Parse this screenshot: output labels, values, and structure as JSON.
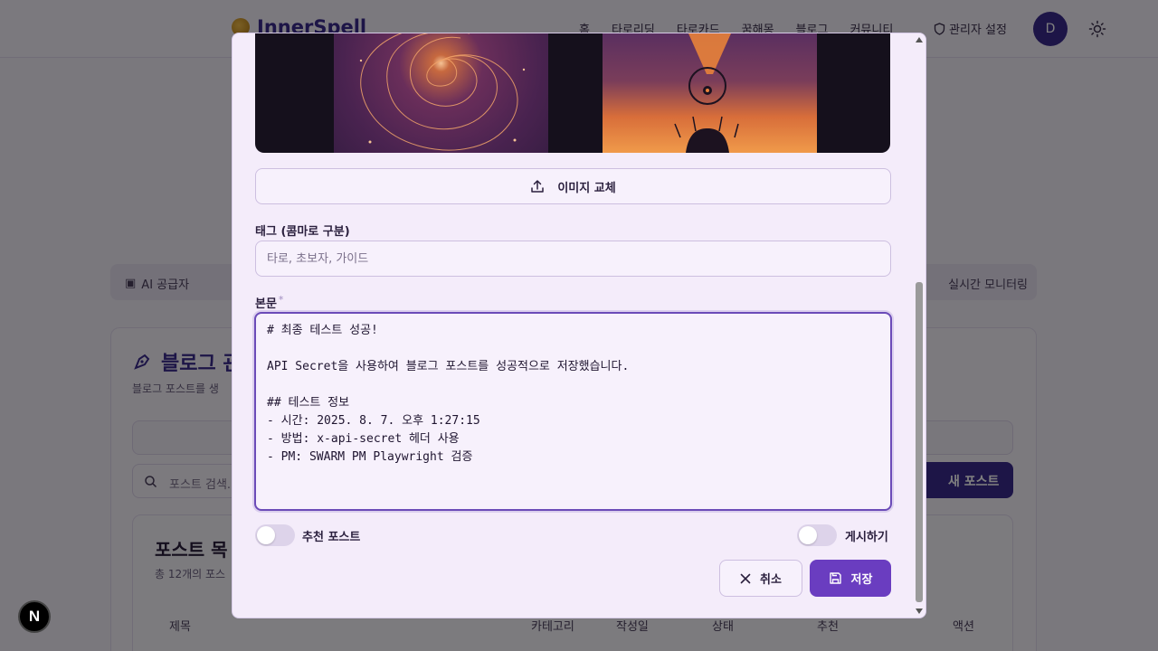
{
  "background": {
    "logo_text": "InnerSpell",
    "nav": [
      "홈",
      "타로리딩",
      "타로카드",
      "꿈해몽",
      "블로그",
      "커뮤니티"
    ],
    "admin_link": "관리자 설정",
    "avatar_letter": "D",
    "tabs": {
      "first": "AI 공급자",
      "last": "실시간 모니터링"
    },
    "panel_title": "블로그 관",
    "panel_subtitle": "블로그 포스트를 생",
    "search_placeholder": "포스트 검색...",
    "new_post_label": "새 포스트",
    "list_title": "포스트 목",
    "list_count": "총 12개의 포스",
    "columns": [
      "제목",
      "카테고리",
      "작성일",
      "상태",
      "추천",
      "액션"
    ]
  },
  "modal": {
    "replace_image_label": "이미지 교체",
    "tags_label": "태그 (콤마로 구분)",
    "tags_placeholder": "타로, 초보자, 가이드",
    "body_label": "본문",
    "body_required_mark": "*",
    "body_text": "# 최종 테스트 성공!\n\nAPI Secret을 사용하여 블로그 포스트를 성공적으로 저장했습니다.\n\n## 테스트 정보\n- 시간: 2025. 8. 7. 오후 1:27:15\n- 방법: x-api-secret 헤더 사용\n- PM: SWARM PM Playwright 검증",
    "featured_label": "추천 포스트",
    "featured_on": false,
    "publish_label": "게시하기",
    "publish_on": false,
    "cancel_label": "취소",
    "save_label": "저장"
  },
  "icons": {
    "upload": "upload-icon",
    "close": "close-icon",
    "save": "save-icon",
    "shield": "shield-icon",
    "sun": "sun-icon",
    "search": "search-icon"
  },
  "colors": {
    "accent": "#6a3dc0",
    "brand": "#3b2a8f",
    "modal_bg": "#f4ecfa"
  },
  "dev_badge": "N"
}
